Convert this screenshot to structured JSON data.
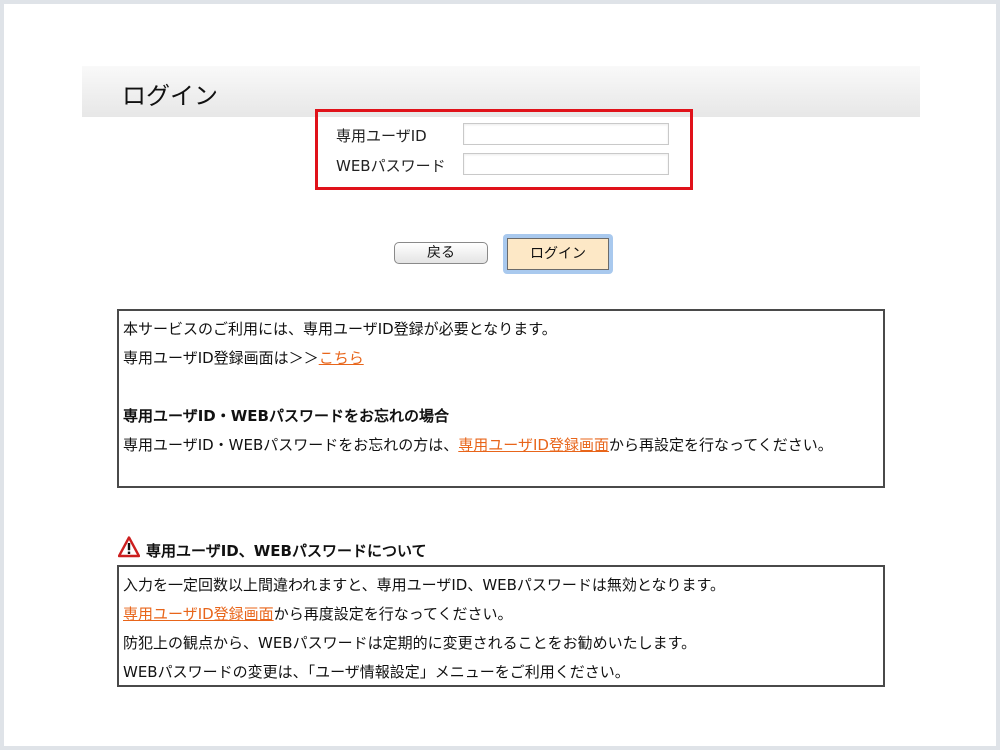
{
  "header": {
    "title": "ログイン"
  },
  "login_form": {
    "user_id_label": "専用ユーザID",
    "user_id_value": "",
    "password_label": "WEBパスワード",
    "password_value": ""
  },
  "buttons": {
    "back_label": "戻る",
    "login_label": "ログイン"
  },
  "info_box": {
    "line1": "本サービスのご利用には、専用ユーザID登録が必要となります。",
    "line2_prefix": "専用ユーザID登録画面は＞＞",
    "line2_link": "こちら",
    "forgot_heading": "専用ユーザID・WEBパスワードをお忘れの場合",
    "forgot_prefix": "専用ユーザID・WEBパスワードをお忘れの方は、",
    "forgot_link": "専用ユーザID登録画面",
    "forgot_suffix": "から再設定を行なってください。"
  },
  "notice": {
    "heading": "専用ユーザID、WEBパスワードについて",
    "line1": "入力を一定回数以上間違われますと、専用ユーザID、WEBパスワードは無効となります。",
    "line2_link": "専用ユーザID登録画面",
    "line2_suffix": "から再度設定を行なってください。",
    "line3": "防犯上の観点から、WEBパスワードは定期的に変更されることをお勧めいたします。",
    "line4": "WEBパスワードの変更は、「ユーザ情報設定」メニューをご利用ください。"
  },
  "colors": {
    "highlight_border": "#e0121a",
    "link": "#e8651a",
    "login_button_bg": "#fde8c6",
    "login_button_focus": "#a9c9ee",
    "warning_icon": "#cc1f1f"
  },
  "icons": {
    "warning": "warning-triangle-icon"
  }
}
